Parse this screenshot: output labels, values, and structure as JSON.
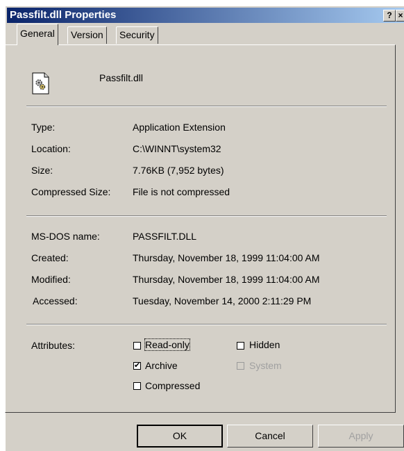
{
  "window": {
    "title": "Passfilt.dll Properties",
    "help_label": "?",
    "close_label": "×"
  },
  "tabs": [
    {
      "label": "General",
      "active": true
    },
    {
      "label": "Version",
      "active": false
    },
    {
      "label": "Security",
      "active": false
    }
  ],
  "file": {
    "icon": "dll-file-icon",
    "name": "Passfilt.dll"
  },
  "details": [
    {
      "label": "Type:",
      "value": "Application Extension"
    },
    {
      "label": "Location:",
      "value": "C:\\WINNT\\system32"
    },
    {
      "label": "Size:",
      "value": "7.76KB (7,952 bytes)"
    },
    {
      "label": "Compressed Size:",
      "value": "File is not compressed"
    }
  ],
  "dates": [
    {
      "label": "MS-DOS name:",
      "value": "PASSFILT.DLL"
    },
    {
      "label": "Created:",
      "value": "Thursday, November 18, 1999 11:04:00 AM"
    },
    {
      "label": "Modified:",
      "value": "Thursday, November 18, 1999 11:04:00 AM"
    },
    {
      "label": "Accessed:",
      "value": "Tuesday, November 14, 2000 2:11:29 PM"
    }
  ],
  "attributes": {
    "label": "Attributes:",
    "read_only": {
      "label": "Read-only",
      "checked": false,
      "enabled": true
    },
    "hidden": {
      "label": "Hidden",
      "checked": false,
      "enabled": true
    },
    "archive": {
      "label": "Archive",
      "checked": true,
      "enabled": true
    },
    "system": {
      "label": "System",
      "checked": false,
      "enabled": false
    },
    "compressed": {
      "label": "Compressed",
      "checked": false,
      "enabled": true
    }
  },
  "buttons": {
    "ok": "OK",
    "cancel": "Cancel",
    "apply": "Apply"
  },
  "colors": {
    "titlebar_start": "#0a246a",
    "titlebar_end": "#a6caf0",
    "face": "#d4d0c8"
  }
}
